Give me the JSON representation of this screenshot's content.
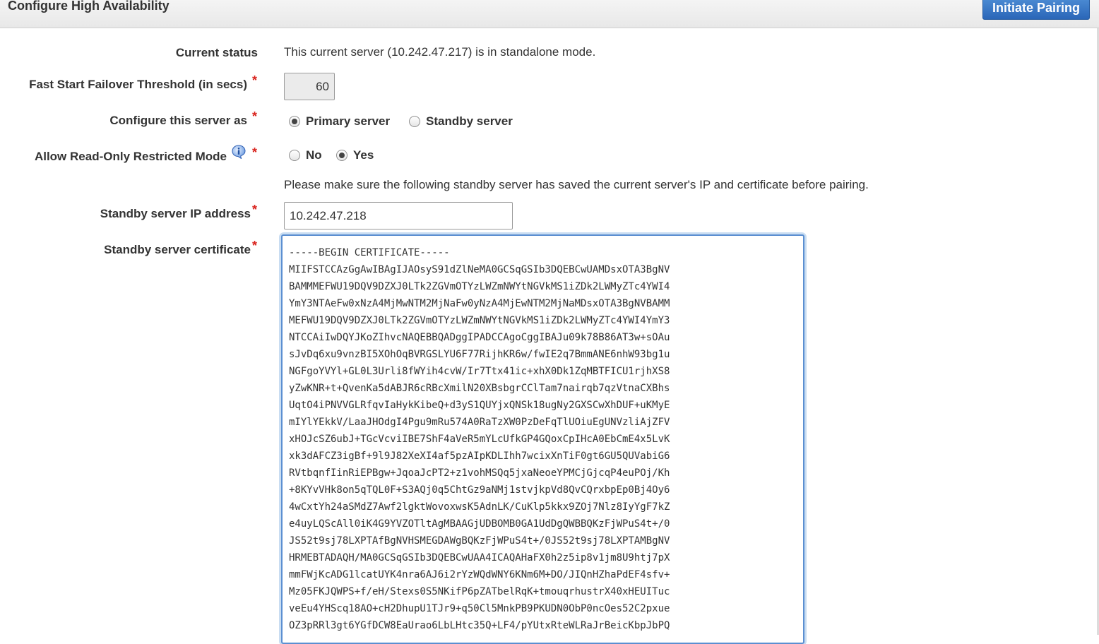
{
  "header": {
    "title": "Configure High Availability",
    "initiate_button": "Initiate Pairing"
  },
  "form": {
    "current_status": {
      "label": "Current status",
      "value": "This current server (10.242.47.217) is in standalone mode."
    },
    "failover_threshold": {
      "label": "Fast Start Failover Threshold (in secs)",
      "value": "60"
    },
    "configure_as": {
      "label": "Configure this server as",
      "options": [
        {
          "label": "Primary server",
          "checked": true
        },
        {
          "label": "Standby server",
          "checked": false
        }
      ]
    },
    "read_only_mode": {
      "label": "Allow Read-Only Restricted Mode",
      "options": [
        {
          "label": "No",
          "checked": false
        },
        {
          "label": "Yes",
          "checked": true
        }
      ]
    },
    "notice": "Please make sure the following standby server has saved the current server's IP and certificate before pairing.",
    "standby_ip": {
      "label": "Standby server IP address",
      "value": "10.242.47.218"
    },
    "standby_cert": {
      "label": "Standby server certificate",
      "value": "-----BEGIN CERTIFICATE-----\nMIIFSTCCAzGgAwIBAgIJAOsyS91dZlNeMA0GCSqGSIb3DQEBCwUAMDsxOTA3BgNV\nBAMMMEFWU19DQV9DZXJ0LTk2ZGVmOTYzLWZmNWYtNGVkMS1iZDk2LWMyZTc4YWI4\nYmY3NTAeFw0xNzA4MjMwNTM2MjNaFw0yNzA4MjEwNTM2MjNaMDsxOTA3BgNVBAMM\nMEFWU19DQV9DZXJ0LTk2ZGVmOTYzLWZmNWYtNGVkMS1iZDk2LWMyZTc4YWI4YmY3\nNTCCAiIwDQYJKoZIhvcNAQEBBQADggIPADCCAgoCggIBAJu09k78B86AT3w+sOAu\nsJvDq6xu9vnzBI5XOhOqBVRGSLYU6F77RijhKR6w/fwIE2q7BmmANE6nhW93bg1u\nNGFgoYVYl+GL0L3Urli8fWYih4cvW/Ir7Ttx41ic+xhX0Dk1ZqMBTFICU1rjhXS8\nyZwKNR+t+QvenKa5dABJR6cRBcXmilN20XBsbgrCClTam7nairqb7qzVtnaCXBhs\nUqtO4iPNVVGLRfqvIaHykKibeQ+d3yS1QUYjxQNSk18ugNy2GXSCwXhDUF+uKMyE\nmIYlYEkkV/LaaJHOdgI4Pgu9mRu574A0RaTzXW0PzDeFqTlUOiuEgUNVzliAjZFV\nxHOJcSZ6ubJ+TGcVcviIBE7ShF4aVeR5mYLcUfkGP4GQoxCpIHcA0EbCmE4x5LvK\nxk3dAFCZ3igBf+9l9J82XeXI4af5pzAIpKDLIhh7wcixXnTiF0gt6GU5QUVabiG6\nRVtbqnfIinRiEPBgw+JqoaJcPT2+z1vohMSQq5jxaNeoeYPMCjGjcqP4euPOj/Kh\n+8KYvVHk8on5qTQL0F+S3AQj0q5ChtGz9aNMj1stvjkpVd8QvCQrxbpEp0Bj4Oy6\n4wCxtYh24aSMdZ7Awf2lgktWovoxwsK5AdnLK/CuKlp5kkx9ZOj7Nlz8IyYgF7kZ\ne4uyLQScAll0iK4G9YVZOTltAgMBAAGjUDBOMB0GA1UdDgQWBBQKzFjWPuS4t+/0\nJS52t9sj78LXPTAfBgNVHSMEGDAWgBQKzFjWPuS4t+/0JS52t9sj78LXPTAMBgNV\nHRMEBTADAQH/MA0GCSqGSIb3DQEBCwUAA4ICAQAHaFX0h2z5ip8v1jm8U9htj7pX\nmmFWjKcADG1lcatUYK4nra6AJ6i2rYzWQdWNY6KNm6M+DO/JIQnHZhaPdEF4sfv+\nMz05FKJQWPS+f/eH/Stexs0S5NKifP6pZATbelRqK+tmouqrhustrX40xHEUITuc\nveEu4YHScq18AO+cH2DhupU1TJr9+q50Cl5MnkPB9PKUDN0ObP0ncOes52C2pxue\nOZ3pRRl3gt6YGfDCW8EaUrao6LbLHtc35Q+LF4/pYUtxRteWLRaJrBeicKbpJbPQ"
    }
  },
  "colors": {
    "required_marker": "#d9231d",
    "primary_button": "#2a66b8",
    "focus_border": "#5b8fd1"
  },
  "icons": {
    "info": "info-icon"
  }
}
